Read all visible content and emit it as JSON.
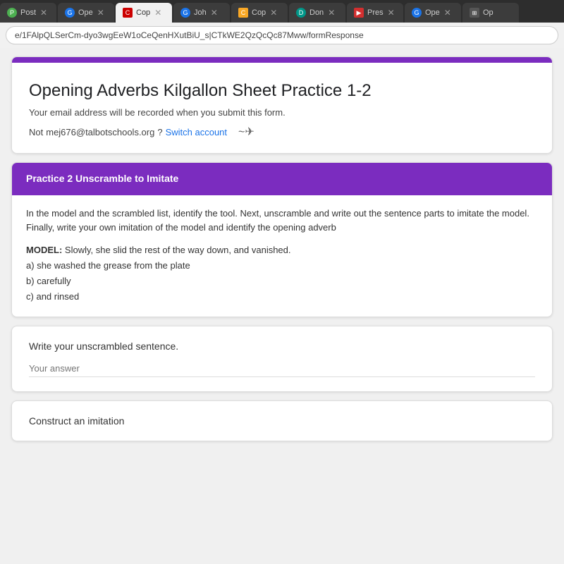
{
  "browser": {
    "tabs": [
      {
        "id": "post",
        "label": "Post",
        "favicon_type": "green",
        "favicon_text": "P",
        "active": false
      },
      {
        "id": "ope1",
        "label": "Ope",
        "favicon_type": "blue",
        "favicon_text": "G",
        "active": false
      },
      {
        "id": "cop1",
        "label": "Cop",
        "favicon_type": "red",
        "favicon_text": "C",
        "active": true
      },
      {
        "id": "john",
        "label": "Joh",
        "favicon_type": "blue",
        "favicon_text": "G",
        "active": false
      },
      {
        "id": "cop2",
        "label": "Cop",
        "favicon_type": "yellow",
        "favicon_text": "C",
        "active": false
      },
      {
        "id": "don",
        "label": "Don",
        "favicon_type": "teal",
        "favicon_text": "D",
        "active": false
      },
      {
        "id": "pres",
        "label": "Pres",
        "favicon_type": "red2",
        "favicon_text": "▶",
        "active": false
      },
      {
        "id": "ope2",
        "label": "Ope",
        "favicon_type": "blue",
        "favicon_text": "G",
        "active": false
      },
      {
        "id": "op2",
        "label": "Op",
        "favicon_type": "grid",
        "favicon_text": "⊞",
        "active": false
      }
    ],
    "address": "e/1FAlpQLSerCm-dyo3wgEeW1oCeQenHXutBiU_s|CTkWE2QzQcQc87Mww/formResponse"
  },
  "form": {
    "title": "Opening Adverbs Kilgallon Sheet Practice 1-2",
    "email_notice": "Your email address will be recorded when you submit this form.",
    "not_label": "Not",
    "email": "mej676@talbotschools.org",
    "switch_label": "Switch account",
    "section": {
      "header": "Practice 2 Unscramble to Imitate",
      "instructions": "In the model and the scrambled list, identify the tool.  Next, unscramble and write out the sentence parts to imitate the model.  Finally, write your own imitation of the model and identify the opening adverb",
      "model_label": "MODEL:",
      "model_sentence": "Slowly, she slid the rest of the way down, and vanished.",
      "parts": [
        {
          "label": "a)",
          "text": "she washed the grease from the plate"
        },
        {
          "label": "b)",
          "text": "carefully"
        },
        {
          "label": "c)",
          "text": "and rinsed"
        }
      ]
    },
    "answer_section": {
      "label": "Write your unscrambled sentence.",
      "placeholder": "Your answer"
    },
    "construct_section": {
      "label": "Construct an imitation"
    }
  }
}
